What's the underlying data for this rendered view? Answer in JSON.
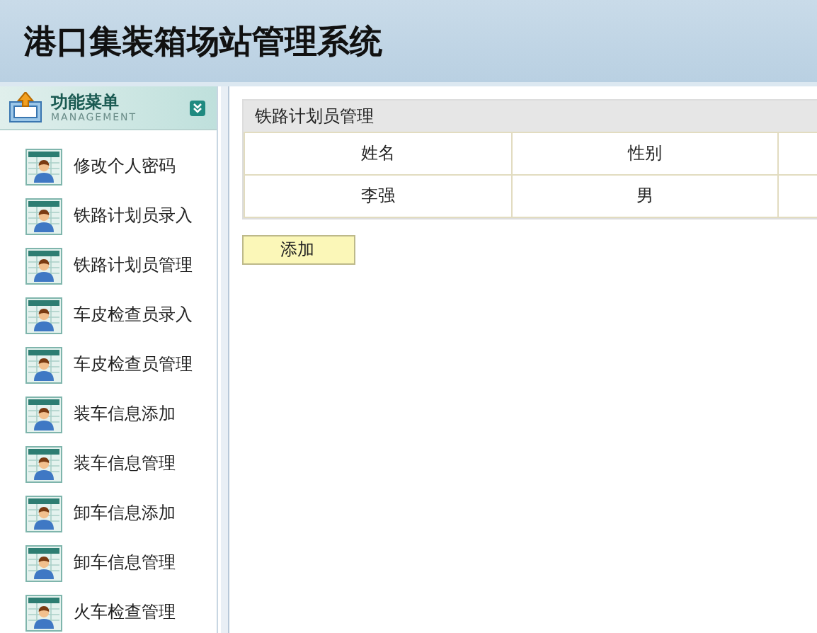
{
  "header": {
    "title": "港口集装箱场站管理系统"
  },
  "sidebar": {
    "title": "功能菜单",
    "subtitle": "MANAGEMENT",
    "items": [
      {
        "label": "修改个人密码"
      },
      {
        "label": "铁路计划员录入"
      },
      {
        "label": "铁路计划员管理"
      },
      {
        "label": "车皮检查员录入"
      },
      {
        "label": "车皮检查员管理"
      },
      {
        "label": "装车信息添加"
      },
      {
        "label": "装车信息管理"
      },
      {
        "label": "卸车信息添加"
      },
      {
        "label": "卸车信息管理"
      },
      {
        "label": "火车检查管理"
      }
    ]
  },
  "panel": {
    "title": "铁路计划员管理",
    "table": {
      "columns": [
        "姓名",
        "性别"
      ],
      "rows": [
        [
          "李强",
          "男"
        ]
      ]
    },
    "buttons": [
      "添加"
    ]
  }
}
